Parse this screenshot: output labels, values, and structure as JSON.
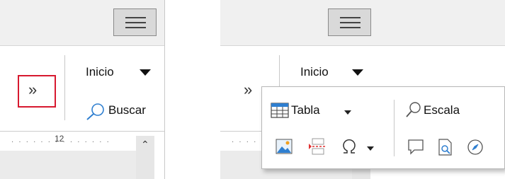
{
  "left_panel": {
    "menu_icon": "hamburger-icon",
    "overflow_icon": "double-chevron-right-icon",
    "highlight_color": "#d7192f",
    "inicio_label": "Inicio",
    "buscar_label": "Buscar",
    "ruler_number": "12"
  },
  "right_panel": {
    "menu_icon": "hamburger-icon",
    "overflow_icon": "double-chevron-right-icon",
    "inicio_label": "Inicio",
    "popup": {
      "tabla_label": "Tabla",
      "escala_label": "Escala",
      "icons": [
        "table-icon",
        "image-icon",
        "page-break-icon",
        "special-character-icon",
        "comment-icon",
        "page-preview-icon",
        "navigator-icon",
        "zoom-icon"
      ]
    }
  },
  "colors": {
    "toolbar_bg": "#f0f0f0",
    "accent_blue": "#2f7fd0"
  }
}
